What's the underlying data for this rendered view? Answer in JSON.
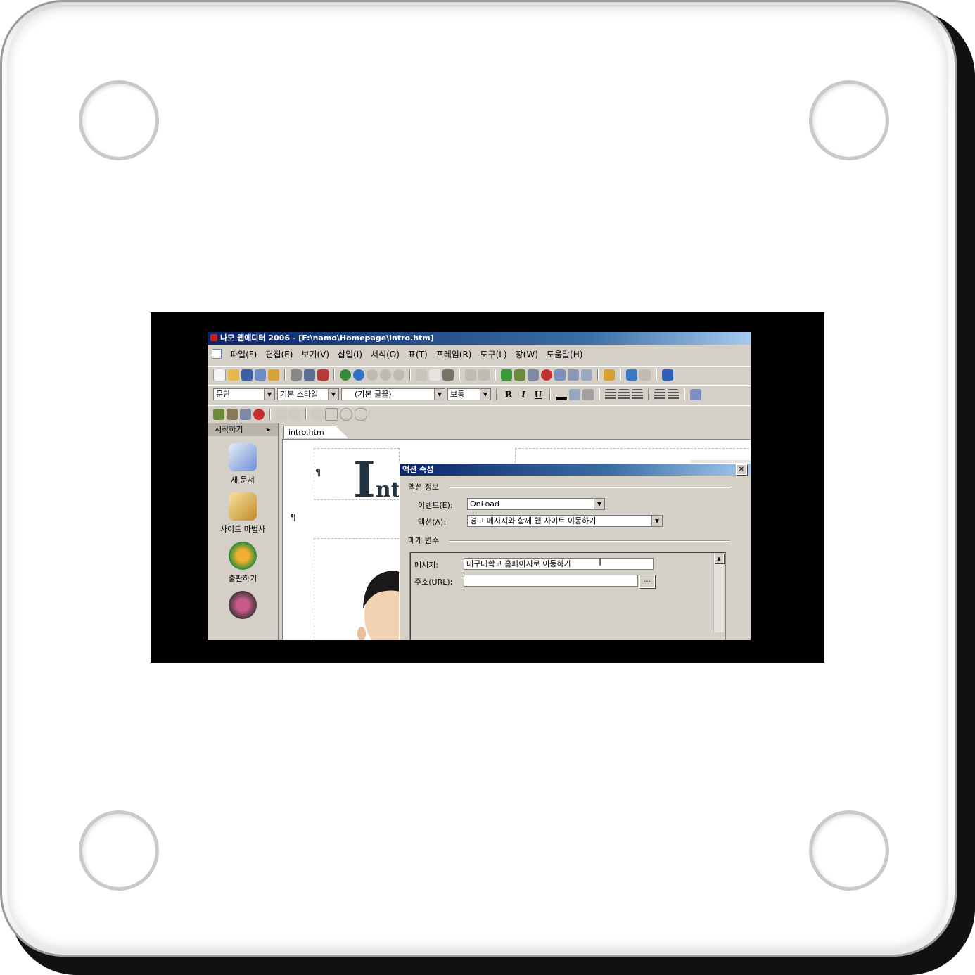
{
  "app": {
    "title": "나모 웹에디터 2006 - [F:\\namo\\Homepage\\intro.htm]"
  },
  "menu": [
    "파일(F)",
    "편집(E)",
    "보기(V)",
    "삽입(I)",
    "서식(O)",
    "표(T)",
    "프레임(R)",
    "도구(L)",
    "창(W)",
    "도움말(H)"
  ],
  "format_bar": {
    "paragraph": "문단",
    "style": "기본 스타일",
    "font": "(기본 글꼴)",
    "size": "보통",
    "bold": "B",
    "italic": "I",
    "underline": "U"
  },
  "left_panel": {
    "header": "시작하기",
    "items": [
      {
        "label": "새 문서",
        "icon": "new-document-icon"
      },
      {
        "label": "사이트 마법사",
        "icon": "site-wizard-icon"
      },
      {
        "label": "출판하기",
        "icon": "publish-icon"
      }
    ]
  },
  "document": {
    "tab": "intro.htm",
    "pilcrow": "¶",
    "heading_fragment_I": "I",
    "heading_fragment_nt": "nt"
  },
  "dialog": {
    "title": "액션 속성",
    "close": "✕",
    "section_action_info": "액션 정보",
    "event_label": "이벤트(E):",
    "event_value": "OnLoad",
    "action_label": "액션(A):",
    "action_value": "경고 메시지와 함께 웹 사이트 이동하기",
    "section_params": "매개 변수",
    "message_label": "메시지:",
    "message_value": "대구대학교 홈페이지로 이동하기",
    "url_label": "주소(URL):",
    "url_value": "",
    "browse": "..."
  },
  "colors": {
    "titlebar": "#0a246a",
    "window_bg": "#d4d0c8",
    "video_bg": "#000000"
  }
}
